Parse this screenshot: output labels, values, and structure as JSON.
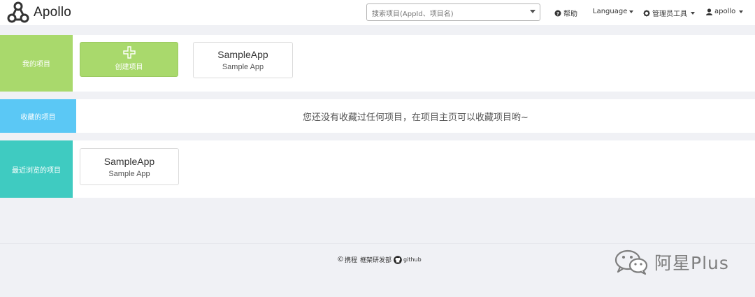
{
  "header": {
    "brand_name": "Apollo",
    "search_placeholder": "搜索项目(AppId、项目名)",
    "help_label": "帮助",
    "language_label": "Language",
    "admin_tools_label": "管理员工具",
    "user_label": "apollo"
  },
  "sections": {
    "my_projects": {
      "label": "我的项目",
      "create_label": "创建项目",
      "apps": [
        {
          "app_id": "SampleApp",
          "app_name": "Sample App"
        }
      ]
    },
    "favorites": {
      "label": "收藏的项目",
      "empty_message": "您还没有收藏过任何项目，在项目主页可以收藏项目哟~"
    },
    "recent": {
      "label": "最近浏览的项目",
      "apps": [
        {
          "app_id": "SampleApp",
          "app_name": "Sample App"
        }
      ]
    }
  },
  "footer": {
    "copyright_symbol": "©",
    "company": "携程",
    "department": "框架研发部",
    "github_label": "github"
  },
  "watermark": {
    "text": "阿星Plus"
  },
  "colors": {
    "page_bg": "#f0f1f5",
    "my_projects": "#a9d96c",
    "favorites": "#5bc8f5",
    "recent": "#3fcbc1"
  }
}
